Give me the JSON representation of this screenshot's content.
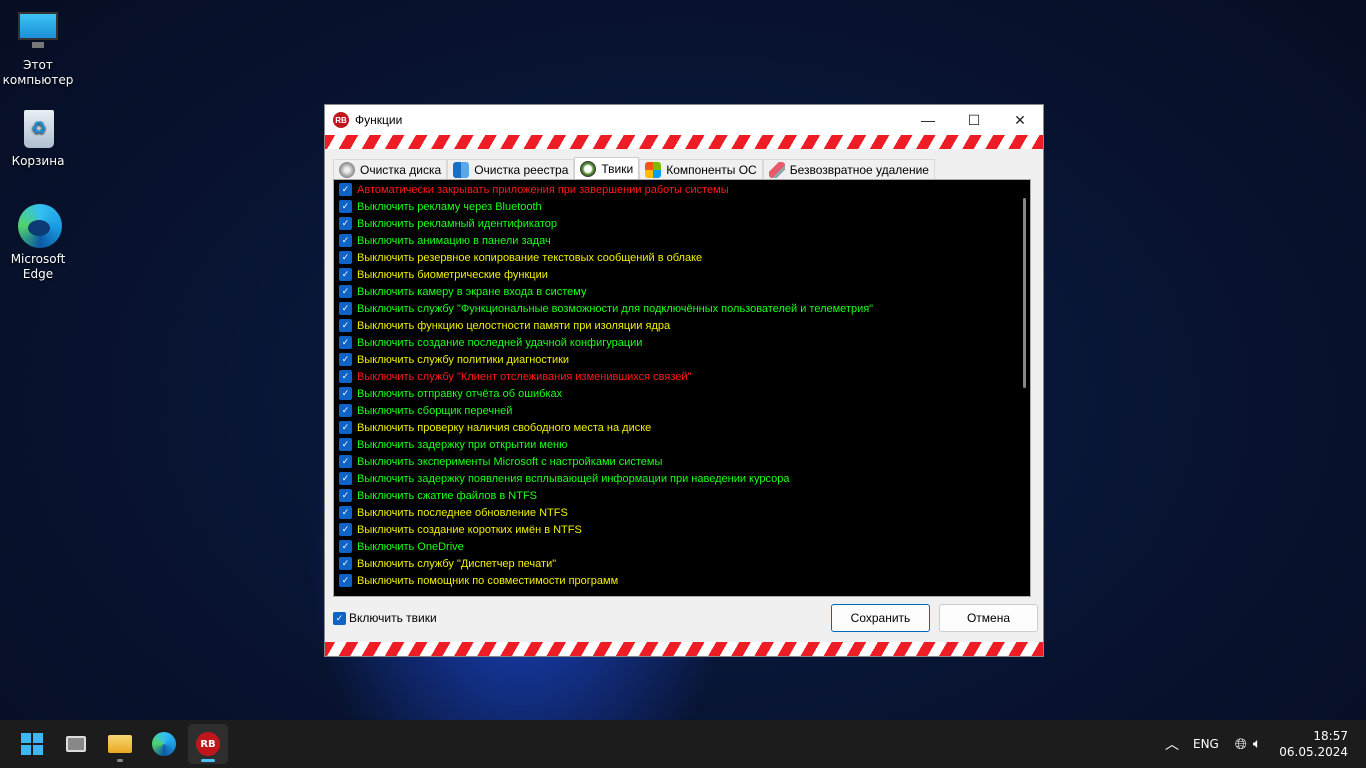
{
  "desktop": {
    "icons": [
      {
        "label": "Этот компьютер"
      },
      {
        "label": "Корзина"
      },
      {
        "label": "Microsoft Edge"
      }
    ]
  },
  "window": {
    "title": "Функции",
    "tabs": [
      {
        "label": "Очистка диска"
      },
      {
        "label": "Очистка реестра"
      },
      {
        "label": "Твики"
      },
      {
        "label": "Компоненты ОС"
      },
      {
        "label": "Безвозвратное удаление"
      }
    ],
    "active_tab": "Твики",
    "items": [
      {
        "label": "Автоматически закрывать приложения при завершении работы системы",
        "color": "#ff1a1a",
        "checked": true
      },
      {
        "label": "Выключить рекламу через Bluetooth",
        "color": "#1aff1a",
        "checked": true
      },
      {
        "label": "Выключить рекламный идентификатор",
        "color": "#1aff1a",
        "checked": true
      },
      {
        "label": "Выключить анимацию в панели задач",
        "color": "#1aff1a",
        "checked": true
      },
      {
        "label": "Выключить резервное копирование текстовых сообщений в облаке",
        "color": "#f0f000",
        "checked": true
      },
      {
        "label": "Выключить биометрические функции",
        "color": "#f0f000",
        "checked": true
      },
      {
        "label": "Выключить камеру в экране входа в систему",
        "color": "#1aff1a",
        "checked": true
      },
      {
        "label": "Выключить службу \"Функциональные возможности для подключённых пользователей и телеметрия\"",
        "color": "#1aff1a",
        "checked": true
      },
      {
        "label": "Выключить функцию целостности памяти при изоляции ядра",
        "color": "#f0f000",
        "checked": true
      },
      {
        "label": "Выключить создание последней удачной конфигурации",
        "color": "#1aff1a",
        "checked": true
      },
      {
        "label": "Выключить службу политики диагностики",
        "color": "#f0f000",
        "checked": true
      },
      {
        "label": "Выключить службу \"Клиент отслеживания изменившихся связей\"",
        "color": "#ff1a1a",
        "checked": true
      },
      {
        "label": "Выключить отправку отчёта об ошибках",
        "color": "#1aff1a",
        "checked": true
      },
      {
        "label": "Выключить сборщик перечней",
        "color": "#1aff1a",
        "checked": true
      },
      {
        "label": "Выключить проверку наличия свободного места на диске",
        "color": "#f0f000",
        "checked": true
      },
      {
        "label": "Выключить задержку при открытии меню",
        "color": "#1aff1a",
        "checked": true
      },
      {
        "label": "Выключить эксперименты Microsoft с настройками системы",
        "color": "#1aff1a",
        "checked": true
      },
      {
        "label": "Выключить задержку появления всплывающей информации при наведении курсора",
        "color": "#1aff1a",
        "checked": true
      },
      {
        "label": "Выключить сжатие файлов в NTFS",
        "color": "#1aff1a",
        "checked": true
      },
      {
        "label": "Выключить последнее обновление NTFS",
        "color": "#f0f000",
        "checked": true
      },
      {
        "label": "Выключить создание коротких имён в NTFS",
        "color": "#f0f000",
        "checked": true
      },
      {
        "label": "Выключить OneDrive",
        "color": "#1aff1a",
        "checked": true
      },
      {
        "label": "Выключить службу \"Диспетчер печати\"",
        "color": "#f0f000",
        "checked": true
      },
      {
        "label": "Выключить помощник по совместимости программ",
        "color": "#f0f000",
        "checked": true
      }
    ],
    "enable_tweaks": {
      "label": "Включить твики",
      "checked": true
    },
    "save_label": "Сохранить",
    "cancel_label": "Отмена"
  },
  "taskbar": {
    "language": "ENG",
    "time": "18:57",
    "date": "06.05.2024"
  }
}
